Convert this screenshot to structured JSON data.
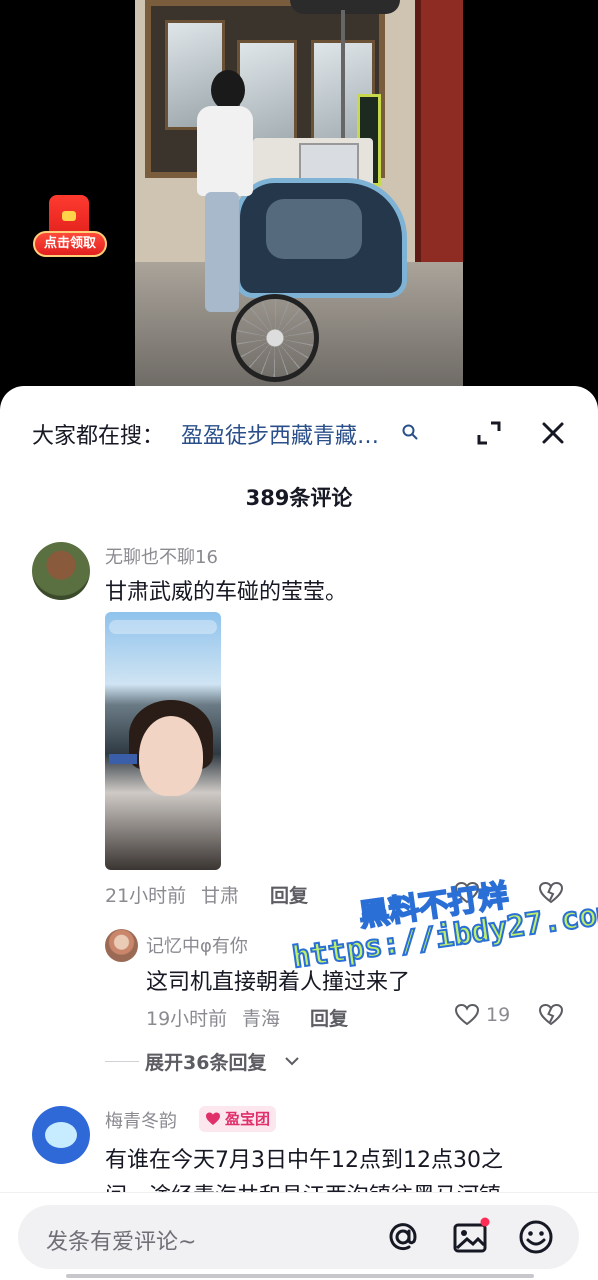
{
  "red_packet": {
    "label": "点击领取"
  },
  "search": {
    "prefix": "大家都在搜：",
    "term": "盈盈徒步西藏青藏…"
  },
  "comments_header": {
    "count_label": "389条评论"
  },
  "comment_1": {
    "username": "无聊也不聊16",
    "text": "甘肃武威的车碰的莹莹。",
    "time": "21小时前",
    "location": "甘肃",
    "reply_label": "回复"
  },
  "reply_1": {
    "username": "记忆中φ有你",
    "text": "这司机直接朝着人撞过来了",
    "time": "19小时前",
    "location": "青海",
    "reply_label": "回复",
    "likes": "19"
  },
  "expand_replies": {
    "label": "展开36条回复"
  },
  "comment_2": {
    "username": "梅青冬韵",
    "badge": "盈宝团",
    "text_line1": "有谁在今天7月3日中午12点到12点30之",
    "text_line2": "间，途经青海共和县江西沟镇往黑马河镇"
  },
  "watermark": {
    "line1": "黑料不打烊",
    "line2": "https://ibdy27.com"
  },
  "input": {
    "placeholder": "发条有爱评论~"
  },
  "colors": {
    "link": "#2a4f8a",
    "badge_bg": "#fde7ee",
    "badge_text": "#e0306a",
    "red": "#e0201b"
  }
}
